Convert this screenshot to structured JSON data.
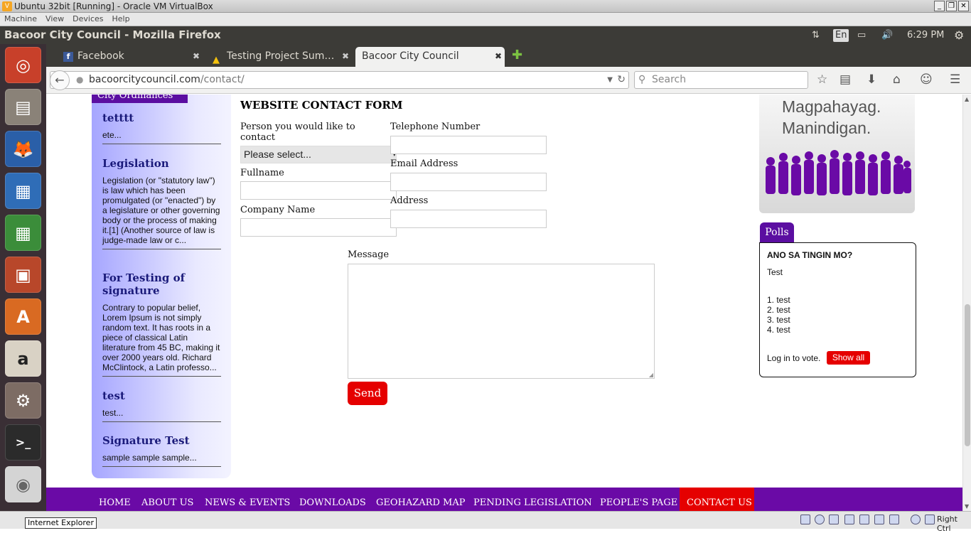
{
  "vbox": {
    "title": "Ubuntu 32bit [Running] - Oracle VM VirtualBox",
    "menu": [
      "Machine",
      "View",
      "Devices",
      "Help"
    ],
    "host_key": "Right Ctrl"
  },
  "ubuntu": {
    "window_title": "Bacoor City Council - Mozilla Firefox",
    "lang": "En",
    "time": "6:29 PM"
  },
  "tabs": [
    {
      "label": "Facebook",
      "icon": "facebook-icon"
    },
    {
      "label": "Testing Project Sum…",
      "icon": "google-drive-icon"
    },
    {
      "label": "Bacoor City Council",
      "icon": "none"
    }
  ],
  "url": {
    "domain": "bacoorcitycouncil.com",
    "path": "/contact/"
  },
  "search": {
    "placeholder": "Search"
  },
  "sidebar": {
    "header": "City Ordinances",
    "items": [
      {
        "title": "tetttt",
        "text": "ete..."
      },
      {
        "title": "Legislation",
        "text": "Legislation (or \"statutory law\") is law which has been promulgated (or \"enacted\") by a legislature or other governing body or the process of making it.[1] (Another source of law is judge-made law or c..."
      },
      {
        "title": "For Testing of signature",
        "text": "Contrary to popular belief, Lorem Ipsum is not simply random text. It has roots in a piece of classical Latin literature from 45 BC, making it over 2000 years old. Richard McClintock, a Latin professo..."
      },
      {
        "title": "test",
        "text": "test..."
      },
      {
        "title": "Signature Test",
        "text": "sample sample sample..."
      }
    ]
  },
  "form": {
    "title": "WEBSITE CONTACT FORM",
    "person_label": "Person you would like to contact",
    "select_value": "Please select...",
    "fullname_label": "Fullname",
    "company_label": "Company Name",
    "telephone_label": "Telephone Number",
    "email_label": "Email Address",
    "address_label": "Address",
    "message_label": "Message",
    "send_label": "Send"
  },
  "banner": {
    "line1": "Magpahayag.",
    "line2": "Manindigan."
  },
  "polls": {
    "tab": "Polls",
    "question": "ANO SA TINGIN MO?",
    "description": "Test",
    "options": [
      "1. test",
      "2. test",
      "3. test",
      "4. test"
    ],
    "login_text": "Log in to vote.",
    "show_all": "Show all"
  },
  "nav": [
    "HOME",
    "ABOUT US",
    "NEWS & EVENTS",
    "DOWNLOADS",
    "GEOHAZARD MAP",
    "PENDING LEGISLATION",
    "PEOPLE'S PAGE",
    "CONTACT US"
  ],
  "tooltip": "Internet Explorer",
  "colors": {
    "purple": "#6a0aa6",
    "red": "#e50000",
    "ubuntu_panel": "#3c3b37"
  }
}
